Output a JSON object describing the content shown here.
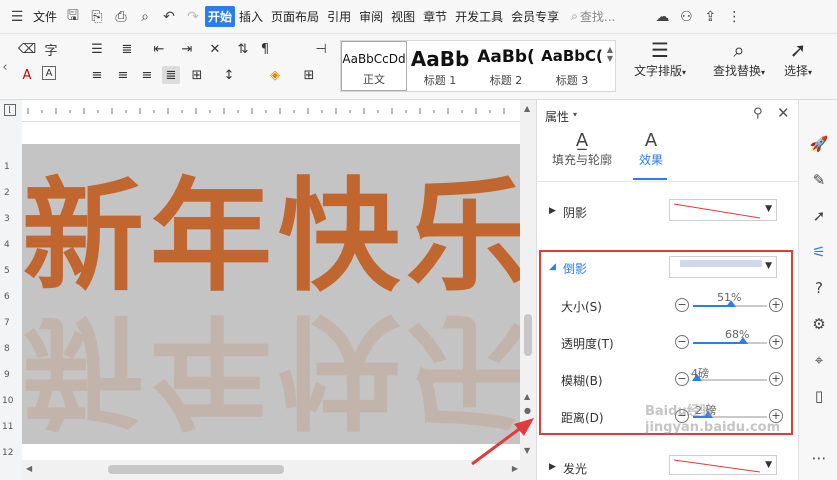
{
  "menu": {
    "file": "文件",
    "tabs": [
      "开始",
      "插入",
      "页面布局",
      "引用",
      "审阅",
      "视图",
      "章节",
      "开发工具",
      "会员专享"
    ],
    "active_tab": "开始",
    "search_placeholder": "查找..."
  },
  "ribbon": {
    "styles": [
      {
        "sample": "AaBbCcDd",
        "name": "正文"
      },
      {
        "sample": "AaBb",
        "name": "标题 1"
      },
      {
        "sample": "AaBb(",
        "name": "标题 2"
      },
      {
        "sample": "AaBbC(",
        "name": "标题 3"
      }
    ],
    "text_layout": "文字排版",
    "find_replace": "查找替换",
    "select": "选择"
  },
  "document": {
    "text": "新年快乐"
  },
  "ruler": {
    "vertical_marks": [
      "1",
      "2",
      "3",
      "4",
      "5",
      "6",
      "7",
      "8",
      "9",
      "10",
      "11",
      "12"
    ]
  },
  "pane": {
    "title": "属性",
    "tab_fill": "填充与轮廓",
    "tab_effect": "效果",
    "shadow_label": "阴影",
    "reflection_label": "倒影",
    "glow_label": "发光",
    "sliders": [
      {
        "label": "大小(S)",
        "value_text": "51%",
        "fraction": 0.51
      },
      {
        "label": "透明度(T)",
        "value_text": "68%",
        "fraction": 0.68
      },
      {
        "label": "模糊(B)",
        "value_text": "4磅",
        "fraction": 0.05
      },
      {
        "label": "距离(D)",
        "value_text": "2 磅",
        "fraction": 0.2
      }
    ]
  },
  "colors": {
    "accent": "#2b7de9",
    "highlight_border": "#e23b3b",
    "text_orange": "#c0662e"
  },
  "watermark": "Baidu经验  jingyan.baidu.com"
}
